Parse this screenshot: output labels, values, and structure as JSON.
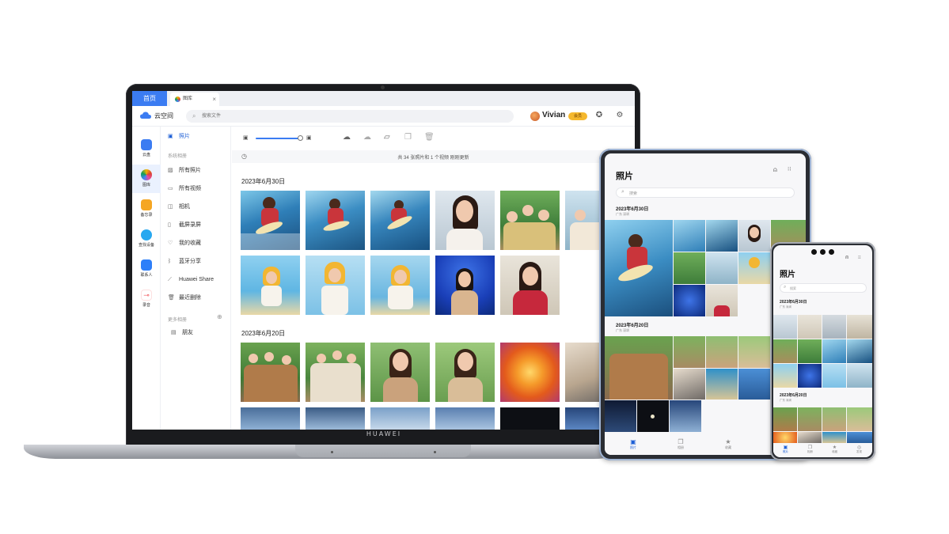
{
  "laptop": {
    "brand": "HUAWEI",
    "tabs": {
      "home": "首页",
      "gallery": "图库",
      "close": "×"
    },
    "app_name": "云空间",
    "search_placeholder": "搜索文件",
    "user": {
      "name": "Vivian",
      "badge": "会员"
    },
    "rail": [
      {
        "label": "云盘",
        "color": "#3b7cf2"
      },
      {
        "label": "图库",
        "color": "#ea4aa0"
      },
      {
        "label": "备忘录",
        "color": "#f5a623"
      },
      {
        "label": "查找设备",
        "color": "#28a8f0"
      },
      {
        "label": "联系人",
        "color": "#2d7ff9"
      },
      {
        "label": "录音",
        "color": "#f2545b"
      }
    ],
    "sidebar": {
      "photos": "照片",
      "system_albums_title": "系统相册",
      "albums": [
        "所有照片",
        "所有视频",
        "相机",
        "截屏录屏",
        "我的收藏",
        "蓝牙分享",
        "Huawei Share",
        "最近删除"
      ],
      "more_albums_title": "更多相册",
      "friends": "朋友"
    },
    "info_text": "共 34 张照片和 1 个视频   刚刚更新",
    "groups": [
      {
        "date": "2023年6月30日"
      },
      {
        "date": "2023年6月20日"
      }
    ]
  },
  "tablet": {
    "title": "照片",
    "search_placeholder": "搜索",
    "groups": [
      {
        "date": "2023年6月30日",
        "sub": "广东 深圳"
      },
      {
        "date": "2023年6月20日",
        "sub": "广东 深圳"
      }
    ],
    "nav": [
      "照片",
      "相册",
      "收藏"
    ]
  },
  "phone": {
    "title": "照片",
    "search_placeholder": "搜索",
    "groups": [
      {
        "date": "2023年6月30日",
        "sub": "广东 深圳"
      },
      {
        "date": "2023年6月20日",
        "sub": "广东 深圳"
      }
    ],
    "nav": [
      "照片",
      "相册",
      "收藏",
      "发现"
    ]
  },
  "colors": {
    "accent": "#3b7cf2",
    "active_text": "#1d5fd6",
    "vip": "#f5b82e"
  },
  "icons": [
    "cloud-logo-icon",
    "search-icon",
    "pinwheel-icon",
    "gear-icon",
    "cloud-upload-icon",
    "cloud-download-icon",
    "folder-icon",
    "copy-icon",
    "trash-icon",
    "clock-icon",
    "plus-circle-icon"
  ]
}
